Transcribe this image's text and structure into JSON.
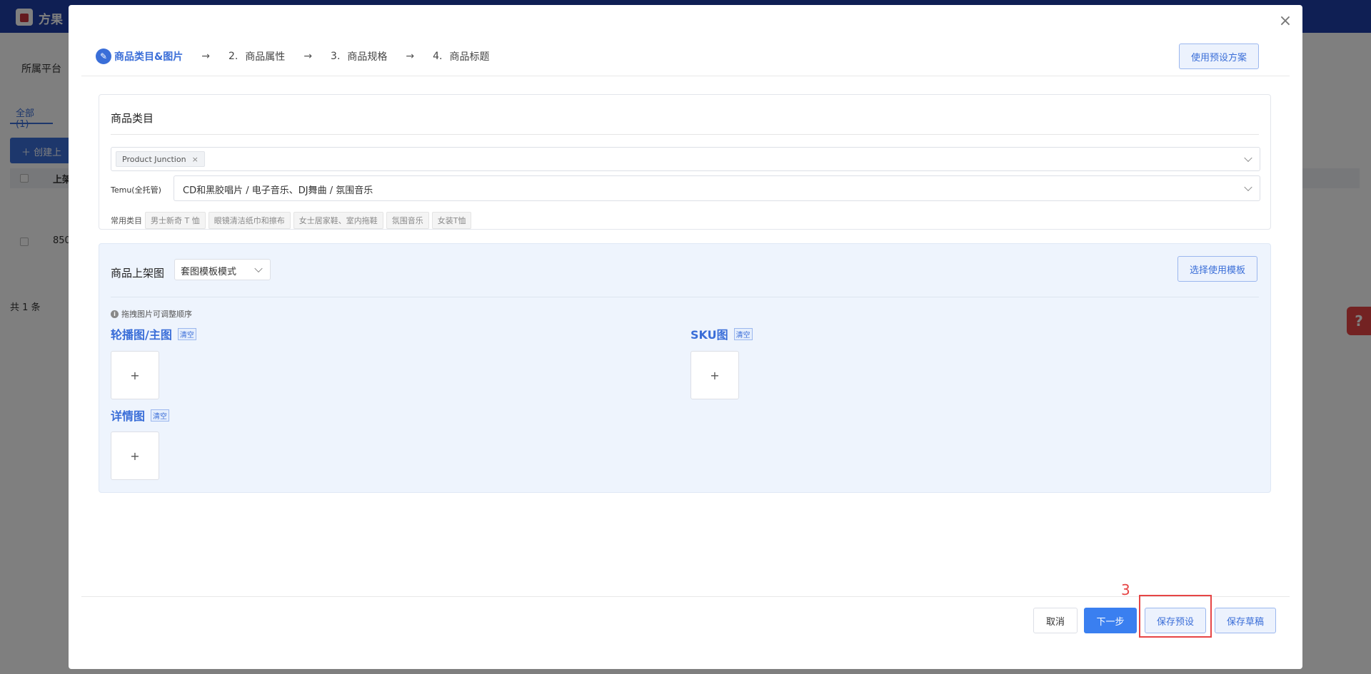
{
  "background": {
    "brand": "方果",
    "filter_label": "所属平台",
    "tab_all": "全部(1)",
    "create_button": "创建上",
    "table_col": "上架",
    "row_value": "850",
    "total": "共 1 条",
    "help_icon": "?"
  },
  "modal": {
    "close_icon": "×",
    "steps": [
      {
        "label": "商品类目&图片",
        "active": true
      },
      {
        "num": "2.",
        "label": "商品属性"
      },
      {
        "num": "3.",
        "label": "商品规格"
      },
      {
        "num": "4.",
        "label": "商品标题"
      }
    ],
    "step_arrow": "→",
    "preset_plan_button": "使用预设方案",
    "category": {
      "title": "商品类目",
      "selected_tag": "Product Junction",
      "tag_remove": "×",
      "temu_label": "Temu(全托管)",
      "temu_value": "CD和黑胶唱片 / 电子音乐、DJ舞曲 / 氛围音乐",
      "common_label": "常用类目",
      "common_chips": [
        "男士新奇 T 恤",
        "眼镜清洁纸巾和擦布",
        "女士居家鞋、室内拖鞋",
        "氛围音乐",
        "女装T恤"
      ]
    },
    "images": {
      "title": "商品上架图",
      "mode_value": "套图模板模式",
      "choose_template_button": "选择使用模板",
      "hint": "拖拽图片可调整顺序",
      "carousel_label": "轮播图/主图",
      "sku_label": "SKU图",
      "detail_label": "详情图",
      "clear": "清空",
      "upload_plus": "+"
    },
    "footer": {
      "cancel": "取消",
      "next": "下一步",
      "save_preset": "保存预设",
      "save_draft": "保存草稿"
    },
    "annotation_number": "3"
  },
  "colors": {
    "primary": "#3a6ed8",
    "next_button": "#3a7ff0",
    "highlight": "#e64545"
  }
}
